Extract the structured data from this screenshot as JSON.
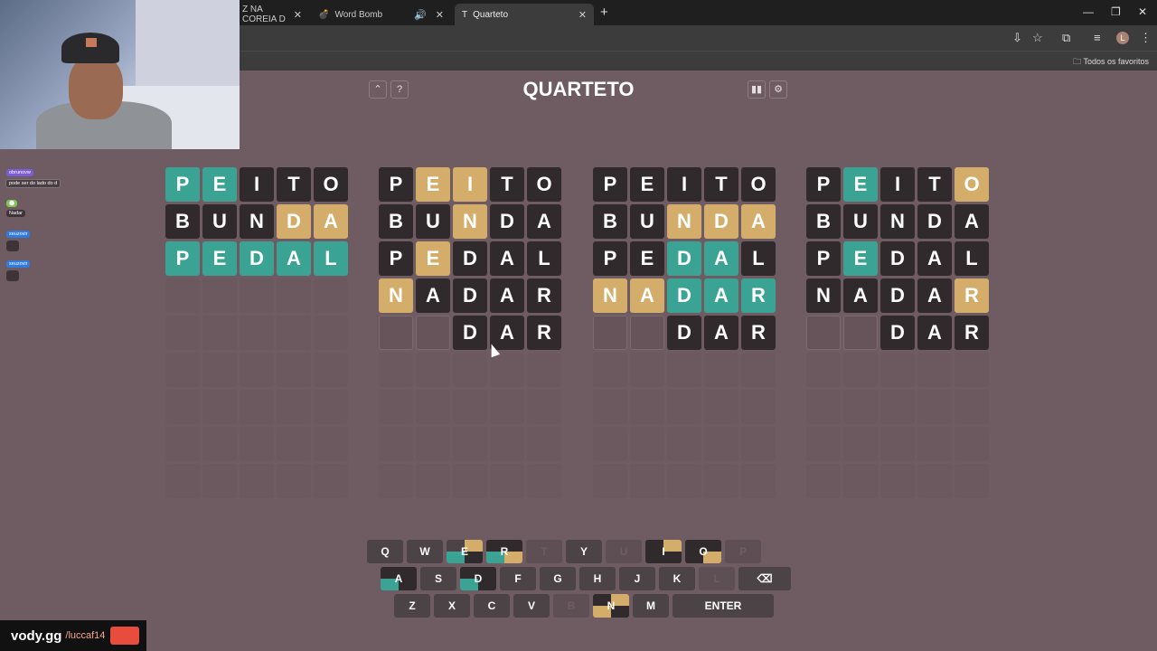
{
  "browser": {
    "tabs": [
      {
        "label": "Z NA COREIA D",
        "active": false
      },
      {
        "label": "Word Bomb",
        "active": false
      },
      {
        "label": "Quarteto",
        "active": true
      }
    ],
    "bookmarks_label": "Todos os favoritos",
    "profile_initial": "L"
  },
  "chat": [
    {
      "user": "obrunovw",
      "text": "pode ser do lado do d",
      "color": "#7b5cd6"
    },
    {
      "user": "Nadar",
      "text": "Nadar",
      "color": "#7bc84f"
    },
    {
      "user": "seuzovir",
      "text": "",
      "color": "#2f7be0"
    },
    {
      "user": "seuzovir",
      "text": "",
      "color": "#2f7be0"
    }
  ],
  "game": {
    "title": "QUARTETO",
    "header_icons": [
      "up-icon",
      "help-icon",
      "stats-icon",
      "settings-icon"
    ],
    "board_rows": 9,
    "boards": [
      {
        "rows": [
          {
            "letters": [
              "P",
              "E",
              "I",
              "T",
              "O"
            ],
            "states": [
              "c",
              "c",
              "a",
              "a",
              "a"
            ]
          },
          {
            "letters": [
              "B",
              "U",
              "N",
              "D",
              "A"
            ],
            "states": [
              "a",
              "a",
              "a",
              "p",
              "p"
            ]
          },
          {
            "letters": [
              "P",
              "E",
              "D",
              "A",
              "L"
            ],
            "states": [
              "c",
              "c",
              "c",
              "c",
              "c"
            ]
          }
        ],
        "typing": null
      },
      {
        "rows": [
          {
            "letters": [
              "P",
              "E",
              "I",
              "T",
              "O"
            ],
            "states": [
              "a",
              "p",
              "p",
              "a",
              "a"
            ]
          },
          {
            "letters": [
              "B",
              "U",
              "N",
              "D",
              "A"
            ],
            "states": [
              "a",
              "a",
              "p",
              "a",
              "a"
            ]
          },
          {
            "letters": [
              "P",
              "E",
              "D",
              "A",
              "L"
            ],
            "states": [
              "a",
              "p",
              "a",
              "a",
              "a"
            ]
          },
          {
            "letters": [
              "N",
              "A",
              "D",
              "A",
              "R"
            ],
            "states": [
              "p",
              "a",
              "a",
              "a",
              "a"
            ]
          }
        ],
        "typing": [
          "",
          "",
          "D",
          "A",
          "R"
        ]
      },
      {
        "rows": [
          {
            "letters": [
              "P",
              "E",
              "I",
              "T",
              "O"
            ],
            "states": [
              "a",
              "a",
              "a",
              "a",
              "a"
            ]
          },
          {
            "letters": [
              "B",
              "U",
              "N",
              "D",
              "A"
            ],
            "states": [
              "a",
              "a",
              "p",
              "p",
              "p"
            ]
          },
          {
            "letters": [
              "P",
              "E",
              "D",
              "A",
              "L"
            ],
            "states": [
              "a",
              "a",
              "c",
              "c",
              "a"
            ]
          },
          {
            "letters": [
              "N",
              "A",
              "D",
              "A",
              "R"
            ],
            "states": [
              "p",
              "p",
              "c",
              "c",
              "c"
            ]
          }
        ],
        "typing": [
          "",
          "",
          "D",
          "A",
          "R"
        ]
      },
      {
        "rows": [
          {
            "letters": [
              "P",
              "E",
              "I",
              "T",
              "O"
            ],
            "states": [
              "a",
              "c",
              "a",
              "a",
              "p"
            ]
          },
          {
            "letters": [
              "B",
              "U",
              "N",
              "D",
              "A"
            ],
            "states": [
              "a",
              "a",
              "a",
              "a",
              "a"
            ]
          },
          {
            "letters": [
              "P",
              "E",
              "D",
              "A",
              "L"
            ],
            "states": [
              "a",
              "c",
              "a",
              "a",
              "a"
            ]
          },
          {
            "letters": [
              "N",
              "A",
              "D",
              "A",
              "R"
            ],
            "states": [
              "a",
              "a",
              "a",
              "a",
              "p"
            ]
          }
        ],
        "typing": [
          "",
          "",
          "D",
          "A",
          "R"
        ]
      }
    ],
    "keyboard": {
      "row1": [
        {
          "k": "Q"
        },
        {
          "k": "W"
        },
        {
          "k": "E",
          "quad": [
            "",
            "#d3ad69",
            "#3aa394",
            "#312a2c"
          ]
        },
        {
          "k": "R",
          "quad": [
            "#312a2c",
            "#312a2c",
            "#3aa394",
            "#d3ad69"
          ]
        },
        {
          "k": "T",
          "used": true
        },
        {
          "k": "Y"
        },
        {
          "k": "U",
          "used": true
        },
        {
          "k": "I",
          "quad": [
            "#312a2c",
            "#d3ad69",
            "#312a2c",
            "#312a2c"
          ]
        },
        {
          "k": "O",
          "quad": [
            "#312a2c",
            "#312a2c",
            "#312a2c",
            "#d3ad69"
          ]
        },
        {
          "k": "P",
          "used": true
        }
      ],
      "row2": [
        {
          "k": "A",
          "quad": [
            "#312a2c",
            "#312a2c",
            "#3aa394",
            "#312a2c"
          ]
        },
        {
          "k": "S"
        },
        {
          "k": "D",
          "quad": [
            "#312a2c",
            "#312a2c",
            "#3aa394",
            "#312a2c"
          ]
        },
        {
          "k": "F"
        },
        {
          "k": "G"
        },
        {
          "k": "H"
        },
        {
          "k": "J"
        },
        {
          "k": "K"
        },
        {
          "k": "L",
          "used": true
        },
        {
          "k": "⌫",
          "special": "back"
        }
      ],
      "row3": [
        {
          "k": "Z"
        },
        {
          "k": "X"
        },
        {
          "k": "C"
        },
        {
          "k": "V"
        },
        {
          "k": "B",
          "used": true
        },
        {
          "k": "N",
          "quad": [
            "#312a2c",
            "#d3ad69",
            "#d3ad69",
            "#312a2c"
          ]
        },
        {
          "k": "M"
        },
        {
          "k": "ENTER",
          "special": "enter"
        }
      ]
    }
  },
  "watermark": {
    "brand": "vody.gg",
    "handle": "/luccaf14"
  }
}
